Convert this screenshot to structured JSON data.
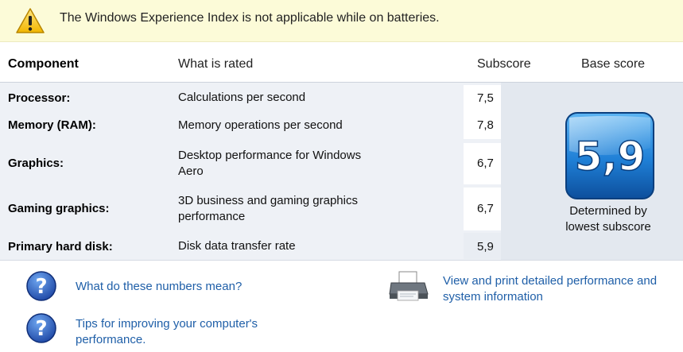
{
  "warning": {
    "text": "The Windows Experience Index is not applicable while on batteries."
  },
  "table": {
    "headers": {
      "component": "Component",
      "what_is_rated": "What is rated",
      "subscore": "Subscore",
      "base_score": "Base score"
    },
    "rows": [
      {
        "component": "Processor:",
        "rated_line1": "Calculations per second",
        "rated_line2": "",
        "subscore": "7,5"
      },
      {
        "component": "Memory (RAM):",
        "rated_line1": "Memory operations per second",
        "rated_line2": "",
        "subscore": "7,8"
      },
      {
        "component": "Graphics:",
        "rated_line1": "Desktop performance for Windows",
        "rated_line2": "Aero",
        "subscore": "6,7"
      },
      {
        "component": "Gaming graphics:",
        "rated_line1": "3D business and gaming graphics",
        "rated_line2": "performance",
        "subscore": "6,7"
      },
      {
        "component": "Primary hard disk:",
        "rated_line1": "Disk data transfer rate",
        "rated_line2": "",
        "subscore": "5,9"
      }
    ],
    "base_score": {
      "value": "5,9",
      "note_line1": "Determined by",
      "note_line2": "lowest subscore"
    }
  },
  "links": {
    "numbers_meaning": "What do these numbers mean?",
    "tips_line1": "Tips for improving your computer's",
    "tips_line2": "performance.",
    "view_print_line1": "View and print detailed performance and",
    "view_print_line2": "system information"
  },
  "icons": {
    "warning": "warning-icon",
    "help": "help-icon",
    "printer": "printer-icon"
  },
  "colors": {
    "warning_bar": "#fcfbd8",
    "link": "#1f5fa8",
    "badge_blue": "#1f7fd6"
  }
}
